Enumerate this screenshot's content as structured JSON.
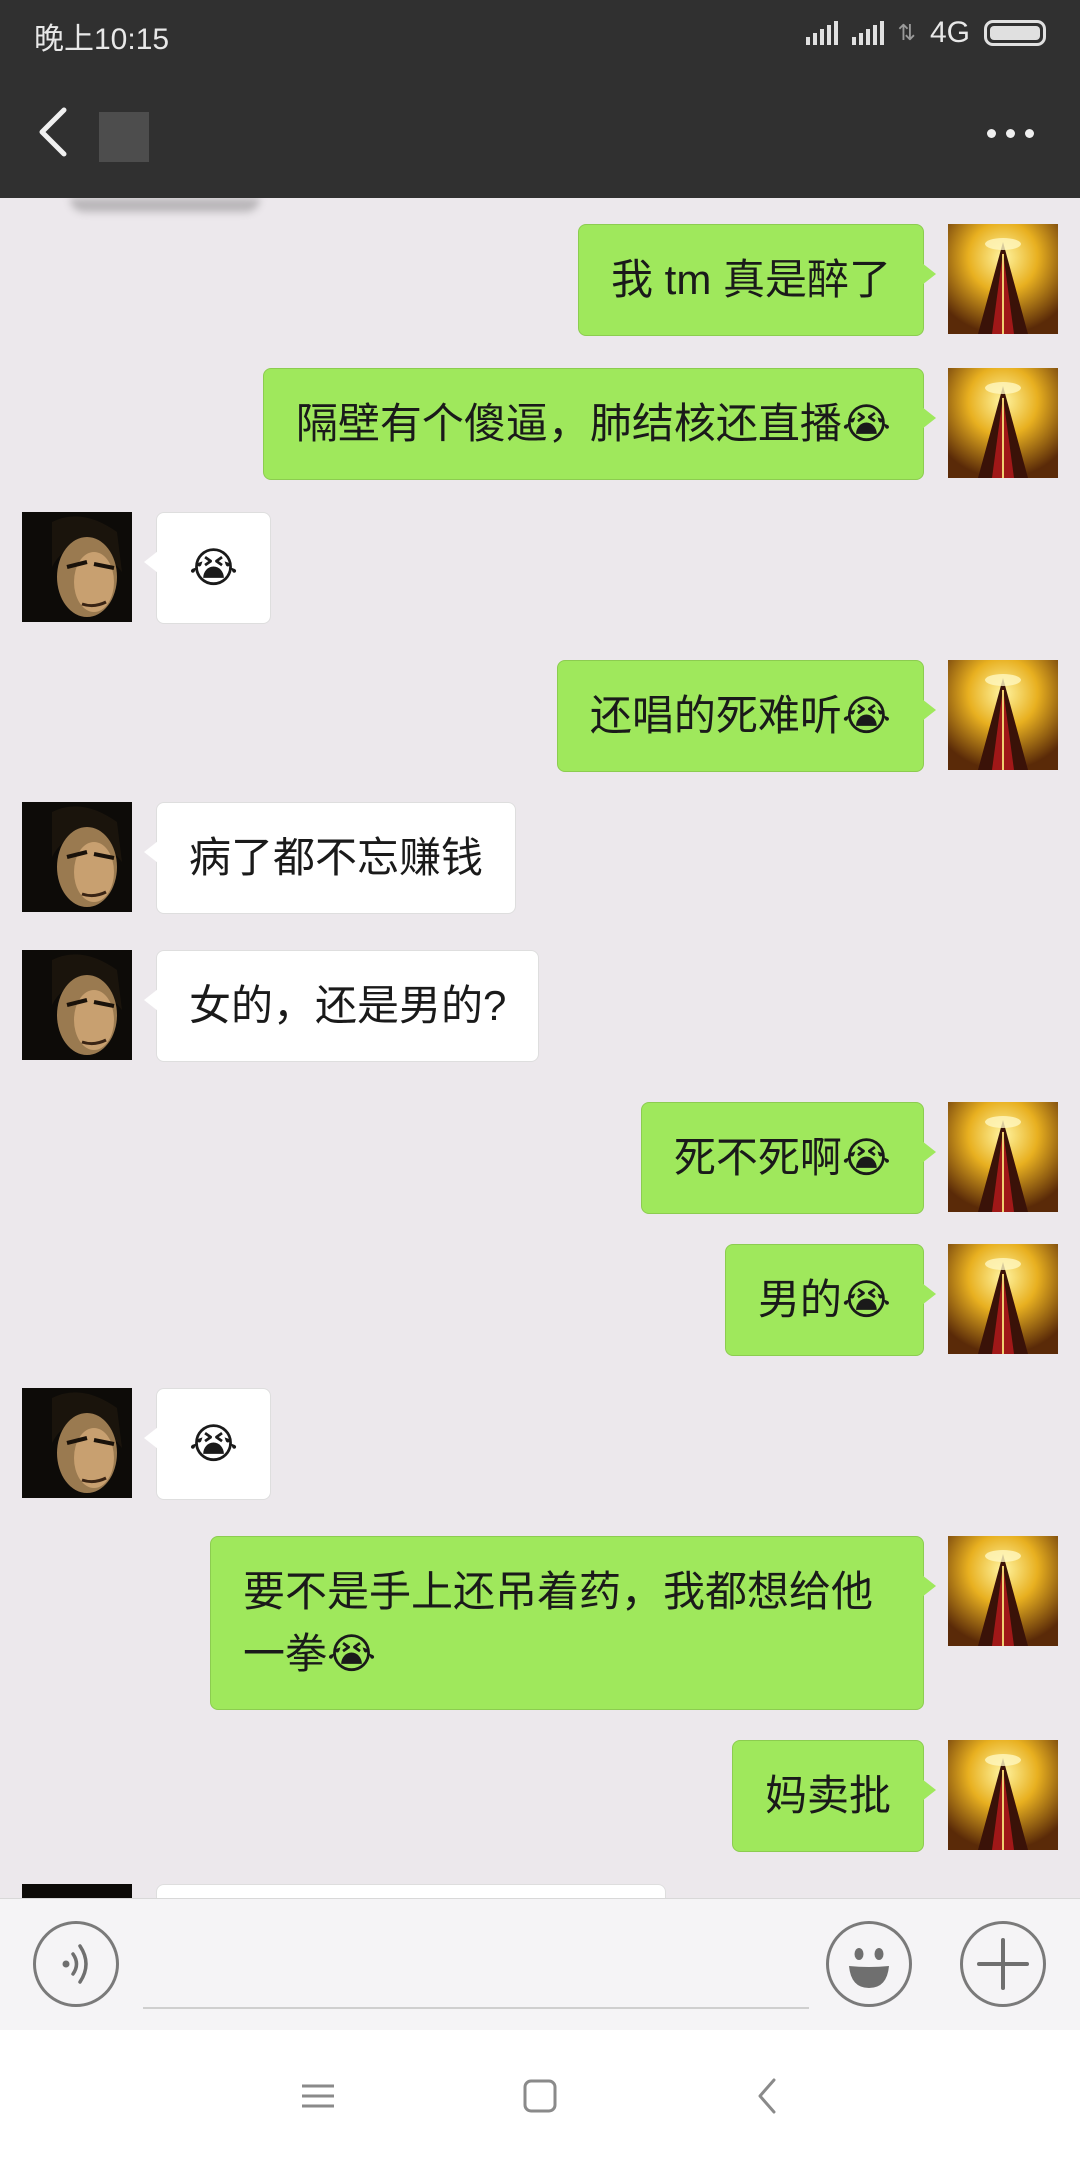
{
  "status_bar": {
    "time": "晚上10:15",
    "network": "4G"
  },
  "title_bar": {
    "back_icon": "chevron-left-icon",
    "more_icon": "more-dots-icon"
  },
  "messages": [
    {
      "from": "me",
      "text": "我 tm 真是醉了"
    },
    {
      "from": "me",
      "text": "隔壁有个傻逼，肺结核还直播😭"
    },
    {
      "from": "them",
      "text": "😭"
    },
    {
      "from": "me",
      "text": "还唱的死难听😭"
    },
    {
      "from": "them",
      "text": "病了都不忘赚钱"
    },
    {
      "from": "them",
      "text": "女的，还是男的?"
    },
    {
      "from": "me",
      "text": "死不死啊😭"
    },
    {
      "from": "me",
      "text": "男的😭"
    },
    {
      "from": "them",
      "text": "😭"
    },
    {
      "from": "me",
      "text": "要不是手上还吊着药，我都想给他一拳😭"
    },
    {
      "from": "me",
      "text": "妈卖批"
    }
  ],
  "input_bar": {
    "voice_icon": "voice-icon",
    "text_value": "",
    "emoji_icon": "smiley-icon",
    "plus_icon": "plus-icon"
  },
  "nav_bar": {
    "menu_icon": "menu-icon",
    "home_icon": "home-square-icon",
    "back_icon": "back-triangle-icon"
  },
  "colors": {
    "chat_background": "#ece8ec",
    "my_bubble": "#9fe85c",
    "their_bubble": "#ffffff",
    "header": "#303030"
  }
}
